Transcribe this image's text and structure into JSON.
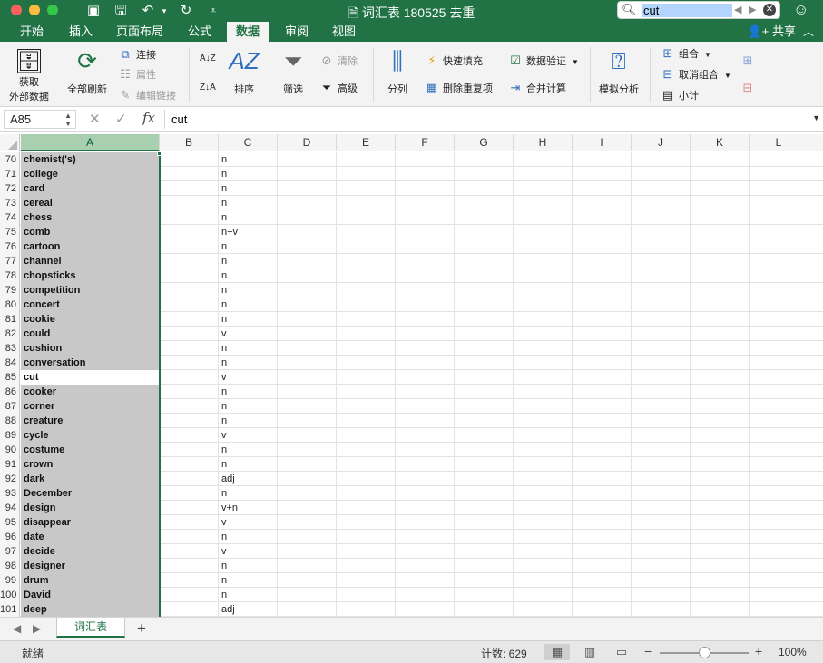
{
  "window": {
    "title": "词汇表 180525 去重",
    "doc_icon": "excel-doc-icon"
  },
  "search": {
    "value": "cut",
    "placeholder": ""
  },
  "ribbon_tabs": [
    "开始",
    "插入",
    "页面布局",
    "公式",
    "数据",
    "审阅",
    "视图"
  ],
  "active_tab": "数据",
  "share_label": "共享",
  "ribbon": {
    "get_external_line1": "获取",
    "get_external_line2": "外部数据",
    "refresh_all": "全部刷新",
    "connections": "连接",
    "properties": "属性",
    "edit_links": "编辑链接",
    "sort": "排序",
    "filter": "筛选",
    "clear": "清除",
    "advanced": "高级",
    "text_to_columns": "分列",
    "flash_fill": "快速填充",
    "remove_duplicates": "删除重复项",
    "data_validation": "数据验证",
    "consolidate": "合并计算",
    "what_if": "模拟分析",
    "group": "组合",
    "ungroup": "取消组合",
    "subtotal": "小计"
  },
  "formula_bar": {
    "name_box": "A85",
    "formula": "cut",
    "fx_label": "fx"
  },
  "columns": [
    "A",
    "B",
    "C",
    "D",
    "E",
    "F",
    "G",
    "H",
    "I",
    "J",
    "K",
    "L"
  ],
  "selected_column": "A",
  "active_row": 85,
  "rows": [
    {
      "n": 70,
      "a": "chemist('s)",
      "c": "n"
    },
    {
      "n": 71,
      "a": "college",
      "c": "n"
    },
    {
      "n": 72,
      "a": "card",
      "c": "n"
    },
    {
      "n": 73,
      "a": "cereal",
      "c": "n"
    },
    {
      "n": 74,
      "a": "chess",
      "c": "n"
    },
    {
      "n": 75,
      "a": "comb",
      "c": "n+v"
    },
    {
      "n": 76,
      "a": "cartoon",
      "c": "n"
    },
    {
      "n": 77,
      "a": "channel",
      "c": "n"
    },
    {
      "n": 78,
      "a": "chopsticks",
      "c": "n"
    },
    {
      "n": 79,
      "a": "competition",
      "c": "n"
    },
    {
      "n": 80,
      "a": "concert",
      "c": "n"
    },
    {
      "n": 81,
      "a": "cookie",
      "c": "n"
    },
    {
      "n": 82,
      "a": "could",
      "c": "v"
    },
    {
      "n": 83,
      "a": "cushion",
      "c": "n"
    },
    {
      "n": 84,
      "a": "conversation",
      "c": "n"
    },
    {
      "n": 85,
      "a": "cut",
      "c": "v"
    },
    {
      "n": 86,
      "a": "cooker",
      "c": "n"
    },
    {
      "n": 87,
      "a": "corner",
      "c": "n"
    },
    {
      "n": 88,
      "a": "creature",
      "c": "n"
    },
    {
      "n": 89,
      "a": "cycle",
      "c": "v"
    },
    {
      "n": 90,
      "a": "costume",
      "c": "n"
    },
    {
      "n": 91,
      "a": "crown",
      "c": "n"
    },
    {
      "n": 92,
      "a": "dark",
      "c": "adj"
    },
    {
      "n": 93,
      "a": "December",
      "c": "n"
    },
    {
      "n": 94,
      "a": "design",
      "c": "v+n"
    },
    {
      "n": 95,
      "a": "disappear",
      "c": "v"
    },
    {
      "n": 96,
      "a": "date",
      "c": "n"
    },
    {
      "n": 97,
      "a": "decide",
      "c": "v"
    },
    {
      "n": 98,
      "a": "designer",
      "c": "n"
    },
    {
      "n": 99,
      "a": "drum",
      "c": "n"
    },
    {
      "n": 100,
      "a": "David",
      "c": "n"
    },
    {
      "n": 101,
      "a": "deep",
      "c": "adj"
    }
  ],
  "sheet_tab": "词汇表",
  "status": {
    "ready": "就绪",
    "count": "计数: 629",
    "zoom": "100%"
  },
  "colors": {
    "accent": "#217346",
    "selection_gray": "#c8c8c8"
  }
}
